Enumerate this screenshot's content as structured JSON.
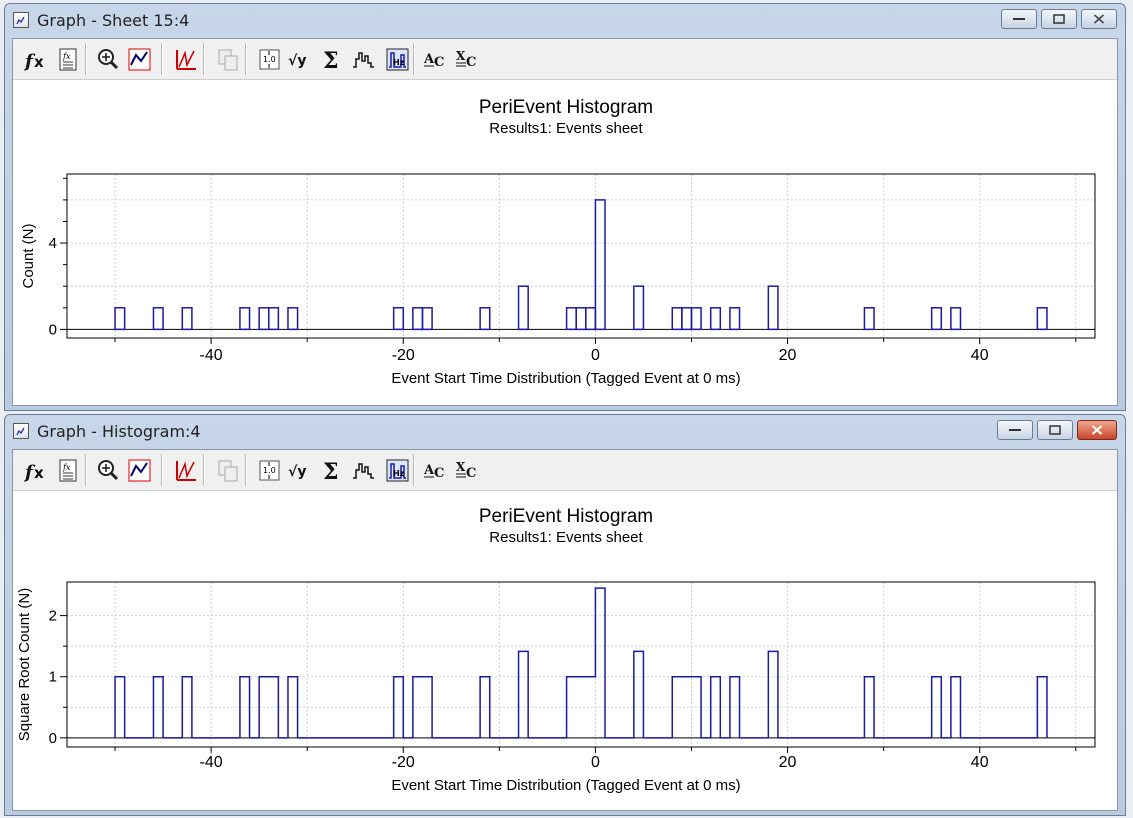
{
  "windows": [
    {
      "id": "top",
      "title": "Graph - Sheet 15:4",
      "toolbar": [
        "function-icon",
        "formula-sheet-icon",
        "zoom-icon",
        "autoscale-icon",
        "line-chart-icon",
        "copy-data-icon",
        "normalize-icon",
        "sqrt-y-icon",
        "sum-icon",
        "histogram-icon",
        "frequency-hz-icon",
        "annotate-c-icon",
        "axis-x-c-icon"
      ],
      "plot": {
        "title": "PeriEvent Histogram",
        "subtitle": "Results1: Events sheet",
        "xlabel": "Event Start Time Distribution (Tagged Event at 0 ms)",
        "ylabel": "Count (N)",
        "x_ticks": [
          "-40",
          "-20",
          "0",
          "20",
          "40"
        ],
        "y_ticks": [
          "0",
          "4"
        ]
      }
    },
    {
      "id": "bot",
      "title": "Graph - Histogram:4",
      "toolbar": [
        "function-icon",
        "formula-sheet-icon",
        "zoom-icon",
        "autoscale-icon",
        "line-chart-icon",
        "copy-data-icon",
        "normalize-icon",
        "sqrt-y-icon",
        "sum-icon",
        "histogram-icon",
        "frequency-hz-icon",
        "annotate-c-icon",
        "axis-x-c-icon"
      ],
      "plot": {
        "title": "PeriEvent Histogram",
        "subtitle": "Results1: Events sheet",
        "xlabel": "Event Start Time Distribution (Tagged Event at 0 ms)",
        "ylabel": "Square Root Count (N)",
        "x_ticks": [
          "-40",
          "-20",
          "0",
          "20",
          "40"
        ],
        "y_ticks": [
          "0",
          "1",
          "2"
        ]
      }
    }
  ],
  "chart_data": [
    {
      "type": "bar",
      "title": "PeriEvent Histogram",
      "subtitle": "Results1: Events sheet",
      "xlabel": "Event Start Time Distribution (Tagged Event at 0 ms)",
      "ylabel": "Count (N)",
      "xlim": [
        -55,
        52
      ],
      "ylim": [
        -0.4,
        7.2
      ],
      "bin_width": 1,
      "bins": [
        [
          -50,
          1
        ],
        [
          -46,
          1
        ],
        [
          -43,
          1
        ],
        [
          -37,
          1
        ],
        [
          -35,
          1
        ],
        [
          -34,
          1
        ],
        [
          -32,
          1
        ],
        [
          -21,
          1
        ],
        [
          -19,
          1
        ],
        [
          -18,
          1
        ],
        [
          -12,
          1
        ],
        [
          -8,
          2
        ],
        [
          -3,
          1
        ],
        [
          -2,
          1
        ],
        [
          -1,
          1
        ],
        [
          0,
          6
        ],
        [
          4,
          2
        ],
        [
          8,
          1
        ],
        [
          9,
          1
        ],
        [
          10,
          1
        ],
        [
          12,
          1
        ],
        [
          14,
          1
        ],
        [
          18,
          2
        ],
        [
          28,
          1
        ],
        [
          35,
          1
        ],
        [
          37,
          1
        ],
        [
          46,
          1
        ]
      ],
      "grid": true,
      "color": "#1a1aa8"
    },
    {
      "type": "line",
      "title": "PeriEvent Histogram",
      "subtitle": "Results1: Events sheet",
      "xlabel": "Event Start Time Distribution (Tagged Event at 0 ms)",
      "ylabel": "Square Root Count (N)",
      "xlim": [
        -55,
        52
      ],
      "ylim": [
        -0.15,
        2.55
      ],
      "step": true,
      "bin_width": 1,
      "bins": [
        [
          -50,
          1
        ],
        [
          -46,
          1
        ],
        [
          -43,
          1
        ],
        [
          -37,
          1
        ],
        [
          -35,
          1
        ],
        [
          -34,
          1
        ],
        [
          -32,
          1
        ],
        [
          -21,
          1
        ],
        [
          -19,
          1
        ],
        [
          -18,
          1
        ],
        [
          -12,
          1
        ],
        [
          -8,
          1.414
        ],
        [
          -3,
          1
        ],
        [
          -2,
          1
        ],
        [
          -1,
          1
        ],
        [
          0,
          2.449
        ],
        [
          4,
          1.414
        ],
        [
          8,
          1
        ],
        [
          9,
          1
        ],
        [
          10,
          1
        ],
        [
          12,
          1
        ],
        [
          14,
          1
        ],
        [
          18,
          1.414
        ],
        [
          28,
          1
        ],
        [
          35,
          1
        ],
        [
          37,
          1
        ],
        [
          46,
          1
        ]
      ],
      "grid": true,
      "color": "#1a1aa8"
    }
  ]
}
